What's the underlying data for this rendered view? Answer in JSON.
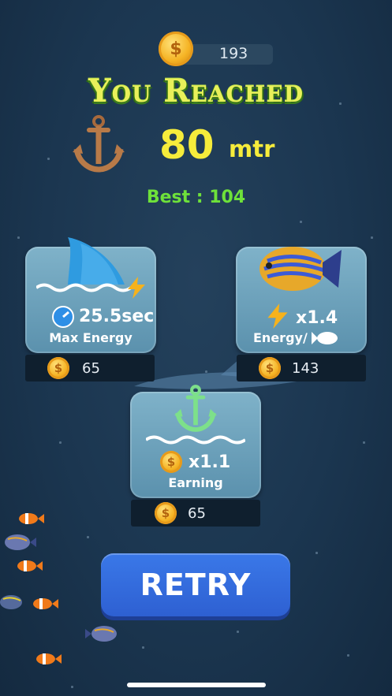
{
  "header": {
    "coins": "193",
    "coin_symbol": "$"
  },
  "result": {
    "title": "You Reached",
    "distance": "80",
    "unit": "mtr",
    "best": "Best : 104"
  },
  "upgrades": {
    "max_energy": {
      "value": "25.5sec",
      "label": "Max Energy",
      "price": "65"
    },
    "energy_fish": {
      "value": "x1.4",
      "label": "Energy/",
      "price": "143"
    },
    "earning": {
      "value": "x1.1",
      "label": "Earning",
      "price": "65"
    }
  },
  "actions": {
    "retry_label": "RETRY"
  },
  "colors": {
    "accent_yellow": "#f6ec3b",
    "best_green": "#6ee13a",
    "retry_blue": "#2e60d2",
    "card_teal": "#6fa4bf"
  },
  "icons": [
    "coin-icon",
    "anchor-icon",
    "shark-fin-icon",
    "lightning-icon",
    "timer-icon",
    "angelfish-icon",
    "fish-icon",
    "wave-icon"
  ]
}
